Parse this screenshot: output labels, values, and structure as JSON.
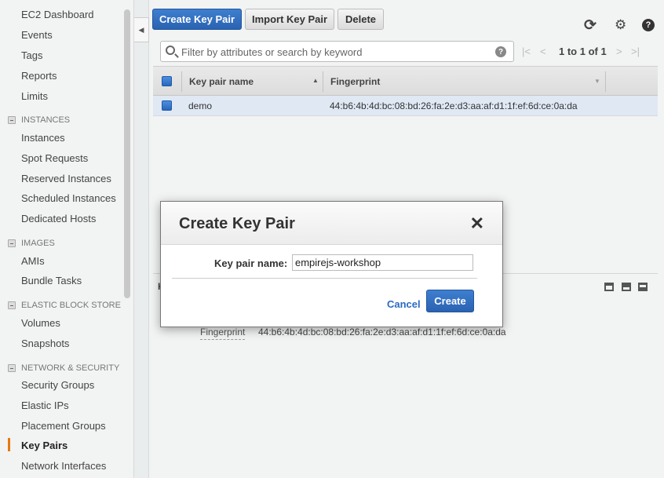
{
  "sidebar": {
    "items": {
      "ec2_dashboard": "EC2 Dashboard",
      "events": "Events",
      "tags": "Tags",
      "reports": "Reports",
      "limits": "Limits",
      "instances": "Instances",
      "spot_requests": "Spot Requests",
      "reserved_instances": "Reserved Instances",
      "scheduled_instances": "Scheduled Instances",
      "dedicated_hosts": "Dedicated Hosts",
      "amis": "AMIs",
      "bundle_tasks": "Bundle Tasks",
      "volumes": "Volumes",
      "snapshots": "Snapshots",
      "security_groups": "Security Groups",
      "elastic_ips": "Elastic IPs",
      "placement_groups": "Placement Groups",
      "key_pairs": "Key Pairs",
      "network_interfaces": "Network Interfaces"
    },
    "sections": {
      "instances": "INSTANCES",
      "images": "IMAGES",
      "ebs": "ELASTIC BLOCK STORE",
      "network": "NETWORK & SECURITY"
    },
    "active_item": "Key Pairs",
    "active_color": "#e47911"
  },
  "toolbar": {
    "create_label": "Create Key Pair",
    "import_label": "Import Key Pair",
    "delete_label": "Delete",
    "refresh_icon": "refresh-icon",
    "settings_icon": "gear-icon",
    "help_icon": "help-icon"
  },
  "search": {
    "placeholder": "Filter by attributes or search by keyword",
    "value": ""
  },
  "pager": {
    "text": "1 to 1 of 1"
  },
  "table": {
    "headers": [
      "Key pair name",
      "Fingerprint"
    ],
    "rows": [
      {
        "name": "demo",
        "fingerprint": "44:b6:4b:4d:bc:08:bd:26:fa:2e:d3:aa:af:d1:1f:ef:6d:ce:0a:da"
      }
    ]
  },
  "detail": {
    "fingerprint_label": "Fingerprint",
    "fingerprint_value": "44:b6:4b:4d:bc:08:bd:26:fa:2e:d3:aa:af:d1:1f:ef:6d:ce:0a:da",
    "header_initial": "K"
  },
  "modal": {
    "title": "Create Key Pair",
    "close_glyph": "✕",
    "field_label": "Key pair name:",
    "field_value": "empirejs-workshop",
    "cancel_label": "Cancel",
    "create_label": "Create",
    "accent_color": "#2a62b1"
  }
}
